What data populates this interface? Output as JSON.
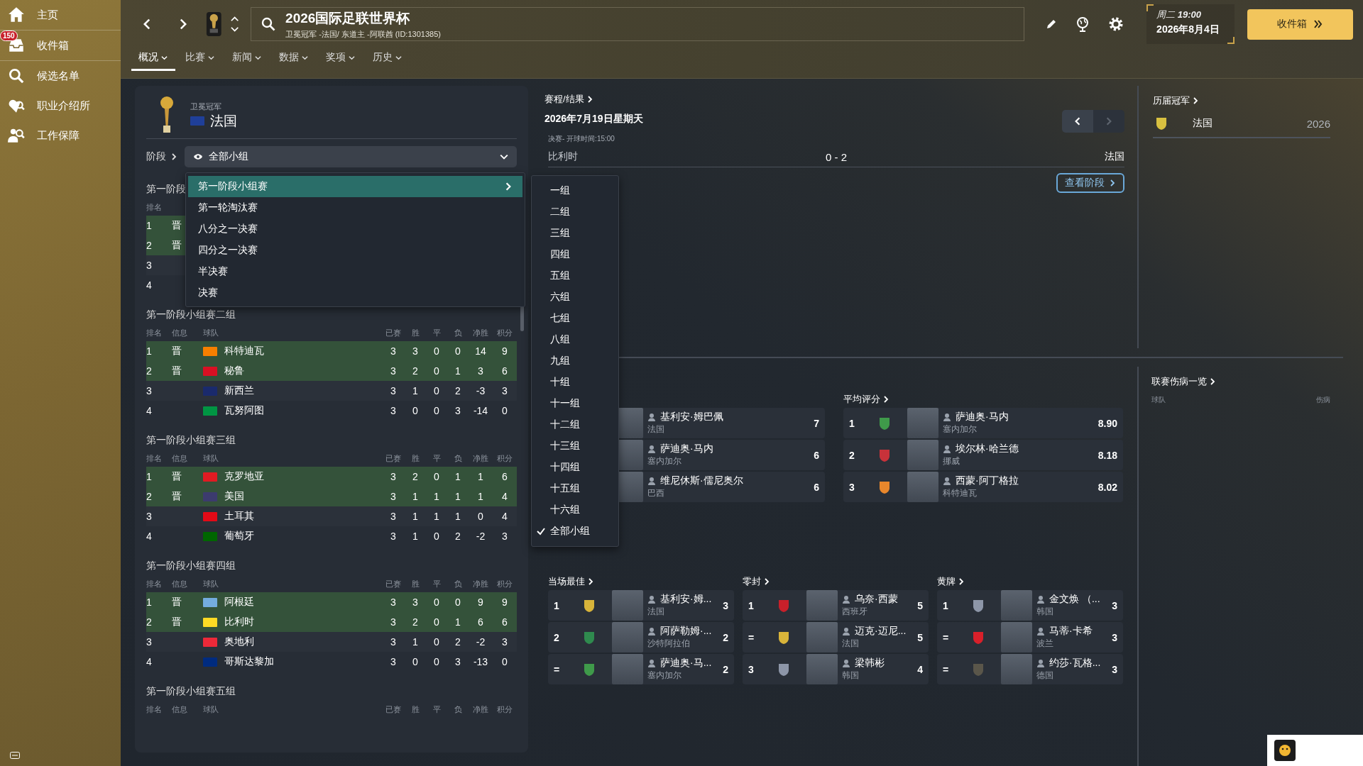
{
  "sidebar": {
    "items": [
      {
        "kind": "home",
        "label": "主页"
      },
      {
        "kind": "inbox",
        "label": "收件箱",
        "badge": "150"
      },
      {
        "kind": "search",
        "label": "候选名单"
      },
      {
        "kind": "agency",
        "label": "职业介绍所"
      },
      {
        "kind": "security",
        "label": "工作保障"
      }
    ]
  },
  "header": {
    "title": "2026国际足联世界杯",
    "subtitle": "卫冕冠军 -法国/ 东道主 -阿联酋 (ID:1301385)",
    "weekday": "周二",
    "time": "19:00",
    "date": "2026年8月4日",
    "continue_button": "收件箱"
  },
  "tabs": [
    {
      "label": "概况",
      "selected": true
    },
    {
      "label": "比赛",
      "selected": false
    },
    {
      "label": "新闻",
      "selected": false
    },
    {
      "label": "数据",
      "selected": false
    },
    {
      "label": "奖项",
      "selected": false
    },
    {
      "label": "历史",
      "selected": false
    }
  ],
  "champion": {
    "caption": "卫冕冠军",
    "team": "法国",
    "color": "#1f3f99"
  },
  "stage": {
    "label": "阶段",
    "value": "全部小组"
  },
  "stage_menu": [
    {
      "label": "第一阶段小组赛",
      "selected": true,
      "has_submenu": true
    },
    {
      "label": "第一轮淘汰赛",
      "selected": false,
      "has_submenu": false
    },
    {
      "label": "八分之一决赛",
      "selected": false,
      "has_submenu": false
    },
    {
      "label": "四分之一决赛",
      "selected": false,
      "has_submenu": false
    },
    {
      "label": "半决赛",
      "selected": false,
      "has_submenu": false
    },
    {
      "label": "决赛",
      "selected": false,
      "has_submenu": false
    }
  ],
  "group_menu": [
    {
      "label": "一组",
      "checked": false
    },
    {
      "label": "二组",
      "checked": false
    },
    {
      "label": "三组",
      "checked": false
    },
    {
      "label": "四组",
      "checked": false
    },
    {
      "label": "五组",
      "checked": false
    },
    {
      "label": "六组",
      "checked": false
    },
    {
      "label": "七组",
      "checked": false
    },
    {
      "label": "八组",
      "checked": false
    },
    {
      "label": "九组",
      "checked": false
    },
    {
      "label": "十组",
      "checked": false
    },
    {
      "label": "十一组",
      "checked": false
    },
    {
      "label": "十二组",
      "checked": false
    },
    {
      "label": "十三组",
      "checked": false
    },
    {
      "label": "十四组",
      "checked": false
    },
    {
      "label": "十五组",
      "checked": false
    },
    {
      "label": "十六组",
      "checked": false
    },
    {
      "label": "全部小组",
      "checked": true
    }
  ],
  "groups": [
    {
      "title": "第一阶段",
      "columns": [
        "排名"
      ],
      "rows": [
        {
          "cells": [
            "1",
            "晋"
          ],
          "qualified": true
        },
        {
          "cells": [
            "2",
            "晋"
          ],
          "qualified": true
        },
        {
          "cells": [
            "3"
          ],
          "qualified": false
        },
        {
          "cells": [
            "4"
          ],
          "qualified": false
        }
      ]
    },
    {
      "title": "第一阶段小组赛二组",
      "columns": [
        "排名",
        "信息",
        "球队",
        "已赛",
        "胜",
        "平",
        "负",
        "净胜",
        "积分"
      ],
      "rows": [
        {
          "cells": [
            "1",
            "晋",
            "科特迪瓦",
            "3",
            "3",
            "0",
            "0",
            "14",
            "9"
          ],
          "color": "#f77f00",
          "qualified": true
        },
        {
          "cells": [
            "2",
            "晋",
            "秘鲁",
            "3",
            "2",
            "0",
            "1",
            "3",
            "6"
          ],
          "color": "#d91023",
          "qualified": true
        },
        {
          "cells": [
            "3",
            "",
            "新西兰",
            "3",
            "1",
            "0",
            "2",
            "-3",
            "3"
          ],
          "color": "#1a2a6c",
          "qualified": false
        },
        {
          "cells": [
            "4",
            "",
            "瓦努阿图",
            "3",
            "0",
            "0",
            "3",
            "-14",
            "0"
          ],
          "color": "#009543",
          "qualified": false
        }
      ]
    },
    {
      "title": "第一阶段小组赛三组",
      "columns": [
        "排名",
        "信息",
        "球队",
        "已赛",
        "胜",
        "平",
        "负",
        "净胜",
        "积分"
      ],
      "rows": [
        {
          "cells": [
            "1",
            "晋",
            "克罗地亚",
            "3",
            "2",
            "0",
            "1",
            "1",
            "6"
          ],
          "color": "#e01b22",
          "qualified": true
        },
        {
          "cells": [
            "2",
            "晋",
            "美国",
            "3",
            "1",
            "1",
            "1",
            "1",
            "4"
          ],
          "color": "#3c3b6e",
          "qualified": true
        },
        {
          "cells": [
            "3",
            "",
            "土耳其",
            "3",
            "1",
            "1",
            "1",
            "0",
            "4"
          ],
          "color": "#e30a17",
          "qualified": false
        },
        {
          "cells": [
            "4",
            "",
            "葡萄牙",
            "3",
            "1",
            "0",
            "2",
            "-2",
            "3"
          ],
          "color": "#006600",
          "qualified": false
        }
      ]
    },
    {
      "title": "第一阶段小组赛四组",
      "columns": [
        "排名",
        "信息",
        "球队",
        "已赛",
        "胜",
        "平",
        "负",
        "净胜",
        "积分"
      ],
      "rows": [
        {
          "cells": [
            "1",
            "晋",
            "阿根廷",
            "3",
            "3",
            "0",
            "0",
            "9",
            "9"
          ],
          "color": "#74acdf",
          "qualified": true
        },
        {
          "cells": [
            "2",
            "晋",
            "比利时",
            "3",
            "2",
            "0",
            "1",
            "6",
            "6"
          ],
          "color": "#fdda24",
          "qualified": true
        },
        {
          "cells": [
            "3",
            "",
            "奥地利",
            "3",
            "1",
            "0",
            "2",
            "-2",
            "3"
          ],
          "color": "#ed2939",
          "qualified": false
        },
        {
          "cells": [
            "4",
            "",
            "哥斯达黎加",
            "3",
            "0",
            "0",
            "3",
            "-13",
            "0"
          ],
          "color": "#002b7f",
          "qualified": false
        }
      ]
    },
    {
      "title": "第一阶段小组赛五组",
      "columns": [
        "排名",
        "信息",
        "球队",
        "已赛",
        "胜",
        "平",
        "负",
        "净胜",
        "积分"
      ]
    }
  ],
  "fixtures": {
    "title": "赛程/结果",
    "date": "2026年7月19日星期天",
    "pager": [
      {
        "kind": "prev",
        "disabled": false
      },
      {
        "kind": "next",
        "disabled": true
      }
    ],
    "info": "决赛- 开球时间:15:00",
    "home": "比利时",
    "score": "0 - 2",
    "away": "法国",
    "view_button": "查看阶段"
  },
  "leaders_left": {
    "rows": [
      {
        "name": "基利安·姆巴佩",
        "team": "法国",
        "value": "7"
      },
      {
        "name": "萨迪奥·马内",
        "team": "塞内加尔",
        "value": "6"
      },
      {
        "name": "维尼休斯·儒尼奥尔",
        "team": "巴西",
        "value": "6"
      }
    ]
  },
  "average_rating": {
    "title": "平均评分",
    "rows": [
      {
        "rank": "1",
        "color": "#3f9a4a",
        "name": "萨迪奥·马内",
        "team": "塞内加尔",
        "value": "8.90"
      },
      {
        "rank": "2",
        "color": "#c8323a",
        "name": "埃尔林·哈兰德",
        "team": "挪威",
        "value": "8.18"
      },
      {
        "rank": "3",
        "color": "#e8872c",
        "name": "西蒙·阿丁格拉",
        "team": "科特迪瓦",
        "value": "8.02"
      }
    ]
  },
  "player_of_match": {
    "title": "当场最佳",
    "rows": [
      {
        "rank": "1",
        "color": "#d8b43a",
        "name": "基利安·姆...",
        "team": "法国",
        "value": "3"
      },
      {
        "rank": "2",
        "color": "#2f8a4e",
        "name": "阿萨勒姆·...",
        "team": "沙特阿拉伯",
        "value": "2"
      },
      {
        "rank": "=",
        "color": "#3f9a4a",
        "name": "萨迪奥·马...",
        "team": "塞内加尔",
        "value": "2"
      }
    ]
  },
  "clean_sheets": {
    "title": "零封",
    "rows": [
      {
        "rank": "1",
        "color": "#c8202a",
        "name": "乌奈·西蒙",
        "team": "西班牙",
        "value": "5"
      },
      {
        "rank": "=",
        "color": "#d8b43a",
        "name": "迈克·迈尼...",
        "team": "法国",
        "value": "5"
      },
      {
        "rank": "3",
        "color": "#8d96a8",
        "name": "梁韩彬",
        "team": "韩国",
        "value": "4"
      }
    ]
  },
  "yellow_cards": {
    "title": "黄牌",
    "rows": [
      {
        "rank": "1",
        "color": "#8d96a8",
        "name": "金文焕 （...",
        "team": "韩国",
        "value": "3"
      },
      {
        "rank": "=",
        "color": "#d8202a",
        "name": "马蒂·卡希",
        "team": "波兰",
        "value": "3"
      },
      {
        "rank": "=",
        "color": "#5a564a",
        "name": "约莎·瓦格...",
        "team": "德国",
        "value": "3"
      }
    ]
  },
  "champions_history": {
    "title": "历届冠军",
    "rows": [
      {
        "team": "法国",
        "year": "2026",
        "color": "#d8c040"
      }
    ]
  },
  "injuries": {
    "title": "联赛伤病一览",
    "columns": [
      "球队",
      "伤病"
    ]
  }
}
